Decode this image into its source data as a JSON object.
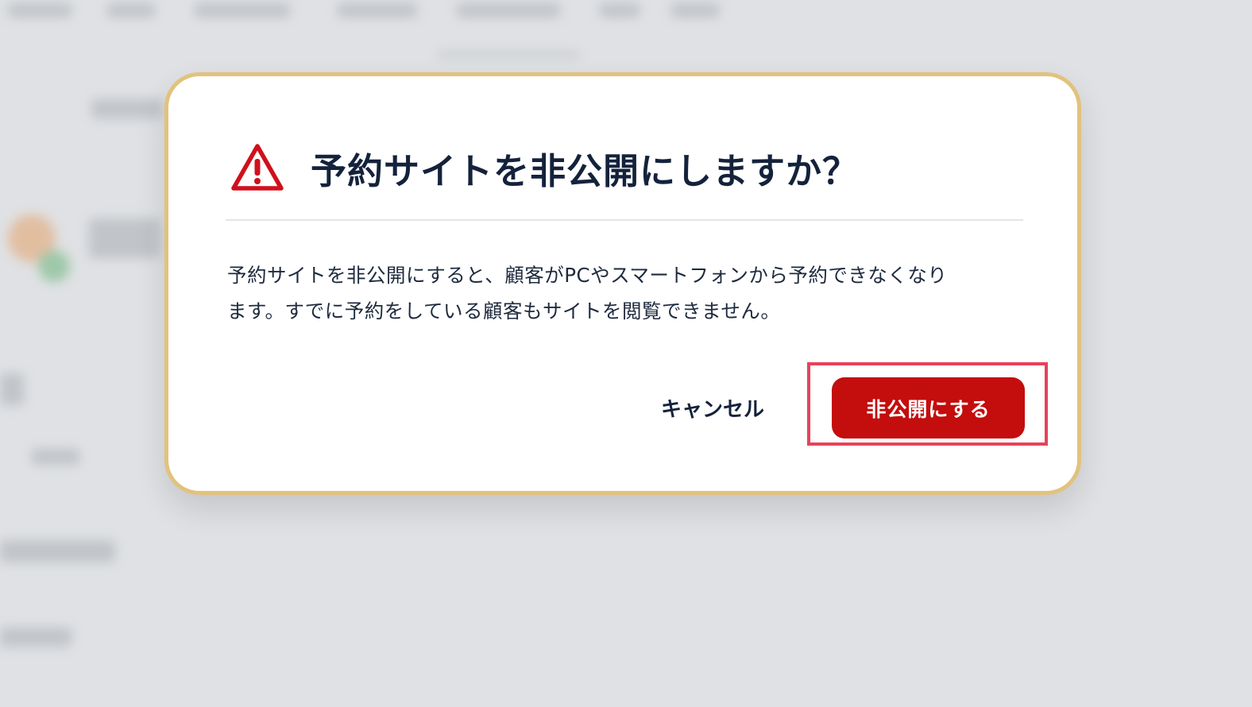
{
  "dialog": {
    "icon": "warning-triangle-icon",
    "title": "予約サイトを非公開にしますか？",
    "body_lines": [
      "予約サイトを非公開にすると、顧客がPCやスマートフォンから予約できなくなり",
      "ます。すでに予約をしている顧客もサイトを閲覧できません。"
    ],
    "cancel_label": "キャンセル",
    "confirm_label": "非公開にする"
  },
  "colors": {
    "dialog_border": "#e2c27c",
    "confirm_button": "#c40d0d",
    "warning_icon": "#d0101c",
    "highlight_box": "#e8425a",
    "title_text": "#14223b",
    "overlay_background": "#dfe1e4"
  }
}
